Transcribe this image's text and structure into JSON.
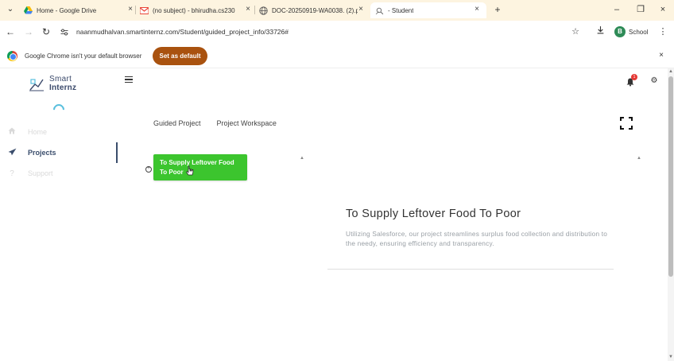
{
  "browser": {
    "tabs": [
      {
        "title": "Home - Google Drive",
        "icon": "google-drive-icon",
        "active": false
      },
      {
        "title": "(no subject) - bhirudha.cs230",
        "icon": "gmail-icon",
        "active": false
      },
      {
        "title": "DOC-20250919-WA0038. (2).p",
        "icon": "globe-icon",
        "active": false
      },
      {
        "title": "- Student",
        "icon": "page-icon",
        "active": true
      }
    ],
    "url": "naanmudhalvan.smartinternz.com/Student/guided_project_info/33726#",
    "profile_initial": "B",
    "profile_label": "School"
  },
  "infobar": {
    "message": "Google Chrome isn't your default browser",
    "button_label": "Set as default",
    "button_color": "#a9520f"
  },
  "brand": {
    "line1": "Smart",
    "line2": "Internz"
  },
  "sidebar": {
    "items": [
      {
        "label": "Home",
        "icon": "home-icon",
        "state": "dim"
      },
      {
        "label": "Projects",
        "icon": "paper-plane-icon",
        "state": "active"
      },
      {
        "label": "Support",
        "icon": "question-icon",
        "state": "dim"
      }
    ]
  },
  "header": {
    "notification_count": "1"
  },
  "project_tabs": [
    {
      "label": "Guided Project"
    },
    {
      "label": "Project Workspace"
    }
  ],
  "steps": [
    {
      "label": "To Supply Leftover Food To Poor",
      "color": "#3cc52e"
    }
  ],
  "project": {
    "title": "To Supply Leftover Food To Poor",
    "description": "Utilizing Salesforce, our project streamlines surplus food collection and distribution to the needy, ensuring efficiency and transparency."
  }
}
